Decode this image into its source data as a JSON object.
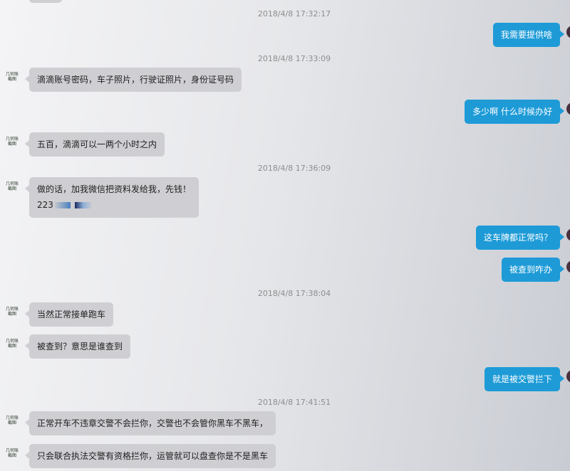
{
  "colors": {
    "incoming_bubble": "#cfcfd3",
    "outgoing_bubble": "#1e9bd7",
    "timestamp": "#8e8e8e"
  },
  "contact_avatar": {
    "icon": "handwritten-avatar-icon",
    "text": "几何账本\n截图"
  },
  "timestamps": {
    "t1": "2018/4/8 17:32:17",
    "t2": "2018/4/8 17:33:09",
    "t3": "2018/4/8 17:36:09",
    "t4": "2018/4/8 17:38:04",
    "t5": "2018/4/8 17:41:51"
  },
  "messages": {
    "m1": "我需要提供啥",
    "m2": "滴滴账号密码，车子照片，行驶证照片，身份证号码",
    "m3": "多少啊 什么时候办好",
    "m4": "五百，滴滴可以一两个小时之内",
    "m5_line1": "做的话，加我微信把资料发给我，先钱！",
    "m5_line2": "223",
    "m6": "这车牌都正常吗？",
    "m7": "被查到咋办",
    "m8": "当然正常接单跑车",
    "m9": "被查到？意思是谁查到",
    "m10": "就是被交警拦下",
    "m11": "正常开车不违章交警不会拦你，交警也不会管你黑车不黑车，",
    "m12": "只会联合执法交警有资格拦你，运管就可以盘查你是不是黑车"
  }
}
